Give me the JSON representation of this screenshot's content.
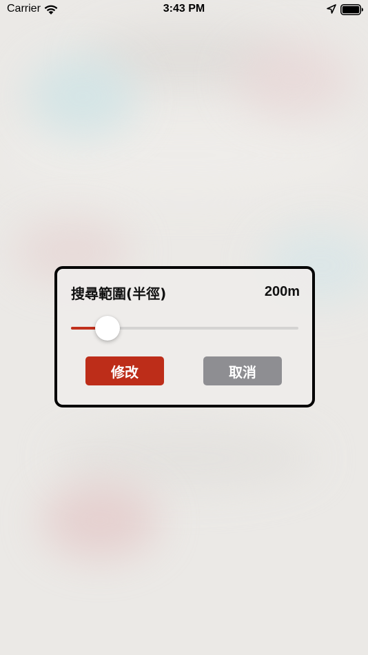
{
  "status_bar": {
    "carrier": "Carrier",
    "time": "3:43 PM",
    "icons": [
      "wifi-icon",
      "location-icon",
      "battery-icon"
    ]
  },
  "dialog": {
    "title": "搜尋範圍(半徑)",
    "value_display": "200m",
    "slider": {
      "fraction": 0.16,
      "fill_color": "#c0301c",
      "track_color": "#d4d3d2"
    },
    "confirm_button": {
      "label": "修改",
      "color": "#bd2d19"
    },
    "cancel_button": {
      "label": "取消",
      "color": "#8e8e92"
    }
  }
}
